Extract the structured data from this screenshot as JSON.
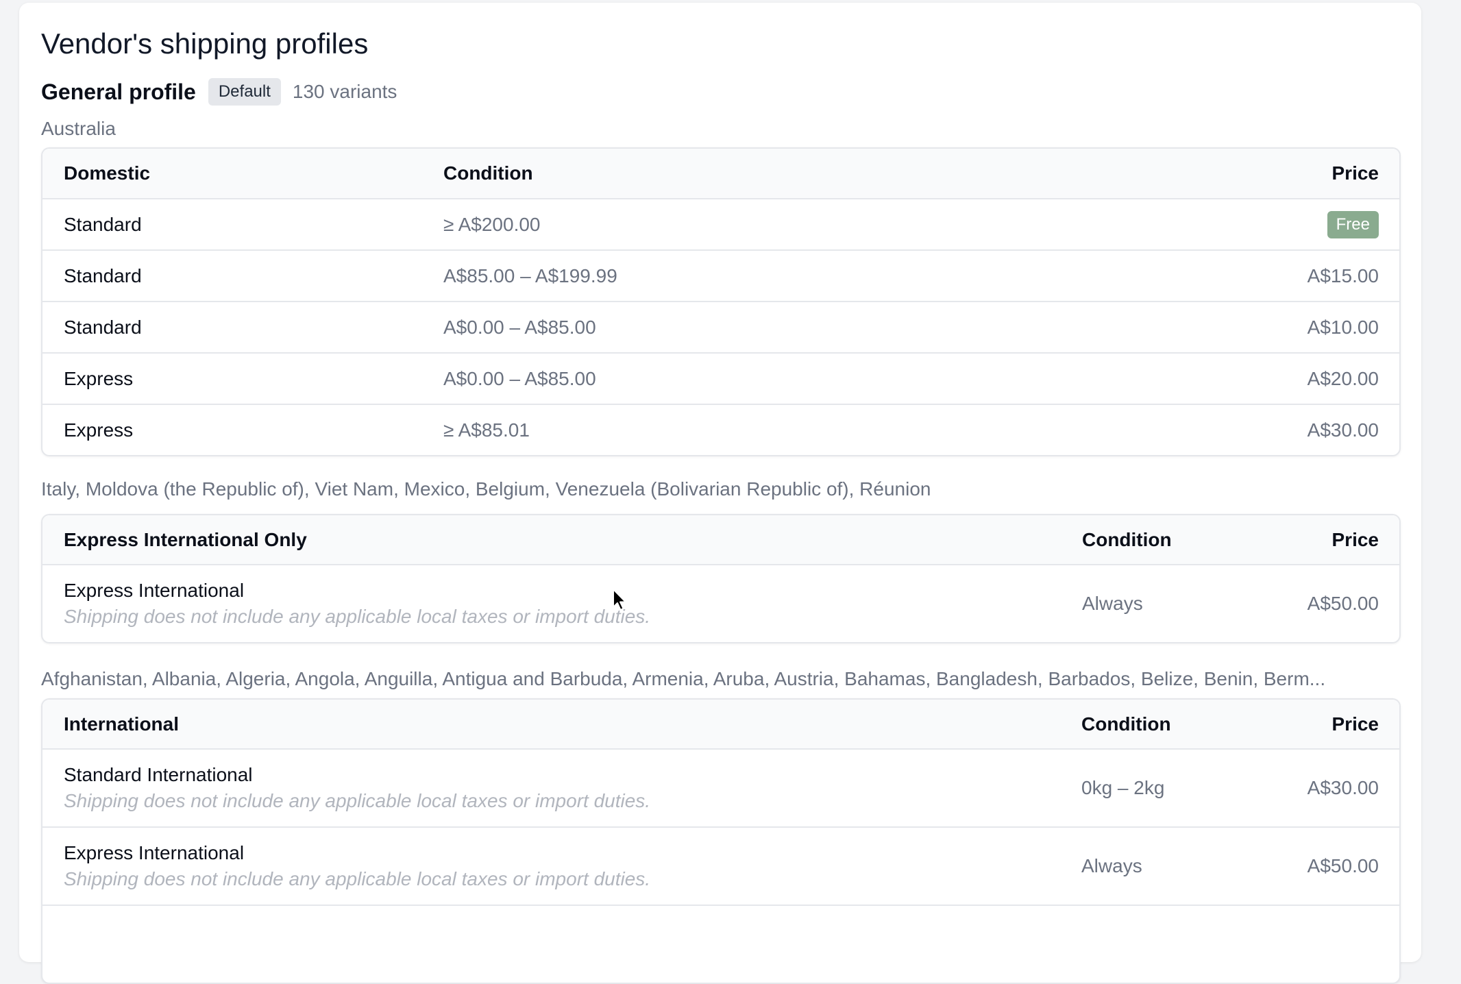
{
  "page": {
    "title": "Vendor's shipping profiles"
  },
  "profile": {
    "name": "General profile",
    "badge": "Default",
    "variants": "130 variants"
  },
  "zones": [
    {
      "label": "Australia",
      "header": {
        "name": "Domestic",
        "condition": "Condition",
        "price": "Price"
      },
      "rows": [
        {
          "name": "Standard",
          "condition": "≥ A$200.00",
          "price": "Free",
          "price_is_badge": true
        },
        {
          "name": "Standard",
          "condition": "A$85.00 – A$199.99",
          "price": "A$15.00"
        },
        {
          "name": "Standard",
          "condition": "A$0.00 – A$85.00",
          "price": "A$10.00"
        },
        {
          "name": "Express",
          "condition": "A$0.00 – A$85.00",
          "price": "A$20.00"
        },
        {
          "name": "Express",
          "condition": "≥ A$85.01",
          "price": "A$30.00"
        }
      ]
    },
    {
      "label": "Italy, Moldova (the Republic of), Viet Nam, Mexico, Belgium, Venezuela (Bolivarian Republic of), Réunion",
      "header": {
        "name": "Express International Only",
        "condition": "Condition",
        "price": "Price"
      },
      "rows": [
        {
          "name": "Express International",
          "note": "Shipping does not include any applicable local taxes or import duties.",
          "condition": "Always",
          "price": "A$50.00"
        }
      ]
    },
    {
      "label": "Afghanistan, Albania, Algeria, Angola, Anguilla, Antigua and Barbuda, Armenia, Aruba, Austria, Bahamas, Bangladesh, Barbados, Belize, Benin, Berm...",
      "header": {
        "name": "International",
        "condition": "Condition",
        "price": "Price"
      },
      "rows": [
        {
          "name": "Standard International",
          "note": "Shipping does not include any applicable local taxes or import duties.",
          "condition": "0kg – 2kg",
          "price": "A$30.00"
        },
        {
          "name": "Express International",
          "note": "Shipping does not include any applicable local taxes or import duties.",
          "condition": "Always",
          "price": "A$50.00"
        }
      ]
    }
  ],
  "colors": {
    "free_badge": "#8aab8f",
    "muted_text": "#6b7280",
    "border": "#e5e7eb"
  }
}
